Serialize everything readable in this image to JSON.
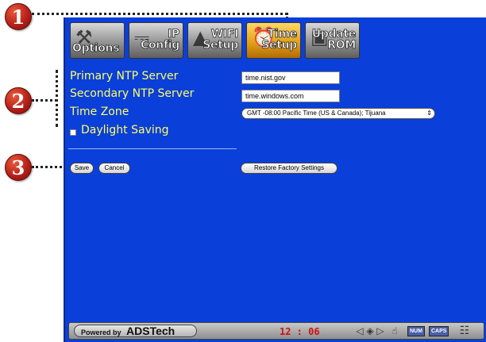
{
  "callouts": [
    "1",
    "2",
    "3"
  ],
  "tabs": [
    {
      "icon": "tools-icon",
      "line1": "",
      "line2": "Options",
      "active": false
    },
    {
      "icon": "network-icon",
      "line1": "IP",
      "line2": "Config",
      "active": false
    },
    {
      "icon": "wireless-icon",
      "line1": "WIFI",
      "line2": "Setup",
      "active": false
    },
    {
      "icon": "clock-icon",
      "line1": "Time",
      "line2": "Setup",
      "active": true
    },
    {
      "icon": "chip-icon",
      "line1": "Update",
      "line2": "ROM",
      "active": false
    }
  ],
  "form": {
    "primary_label": "Primary NTP Server",
    "primary_value": "time.nist.gov",
    "secondary_label": "Secondary NTP Server",
    "secondary_value": "time.windows.com",
    "timezone_label": "Time Zone",
    "timezone_value": "GMT -08:00 Pacific Time (US & Canada); Tijuana",
    "dst_label": "Daylight Saving",
    "dst_checked": false
  },
  "buttons": {
    "save": "Save",
    "cancel": "Cancel",
    "restore": "Restore Factory Settings"
  },
  "statusbar": {
    "powered_prefix": "Powered by",
    "brand": "ADSTech",
    "time": "12 : 06",
    "num": "NUM",
    "caps": "CAPS"
  },
  "colors": {
    "screen_bg": "#0a3fd9",
    "label": "#ffff66",
    "clock": "#d01010",
    "callout": "#b8201a"
  }
}
